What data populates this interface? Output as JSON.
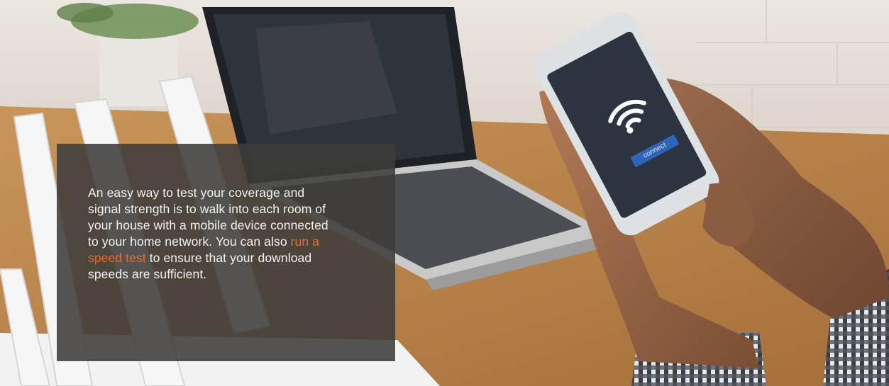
{
  "hero": {
    "image_alt": "Person holding a smartphone showing a Wi-Fi connect screen, next to a laptop and a router on a wooden table",
    "phone_screen": {
      "icon": "wifi-icon",
      "button_label": "connect"
    },
    "caption": {
      "text_before": "An easy way to test your coverage and signal strength is to walk into each room of your house with a mobile device connected to your home network. You can also ",
      "link_label": "run a speed test",
      "text_after": " to ensure that your download speeds are sufficient."
    },
    "colors": {
      "link": "#ef6a2a",
      "caption_bg": "#3e3c3a",
      "caption_text": "#f2f2f2"
    }
  }
}
